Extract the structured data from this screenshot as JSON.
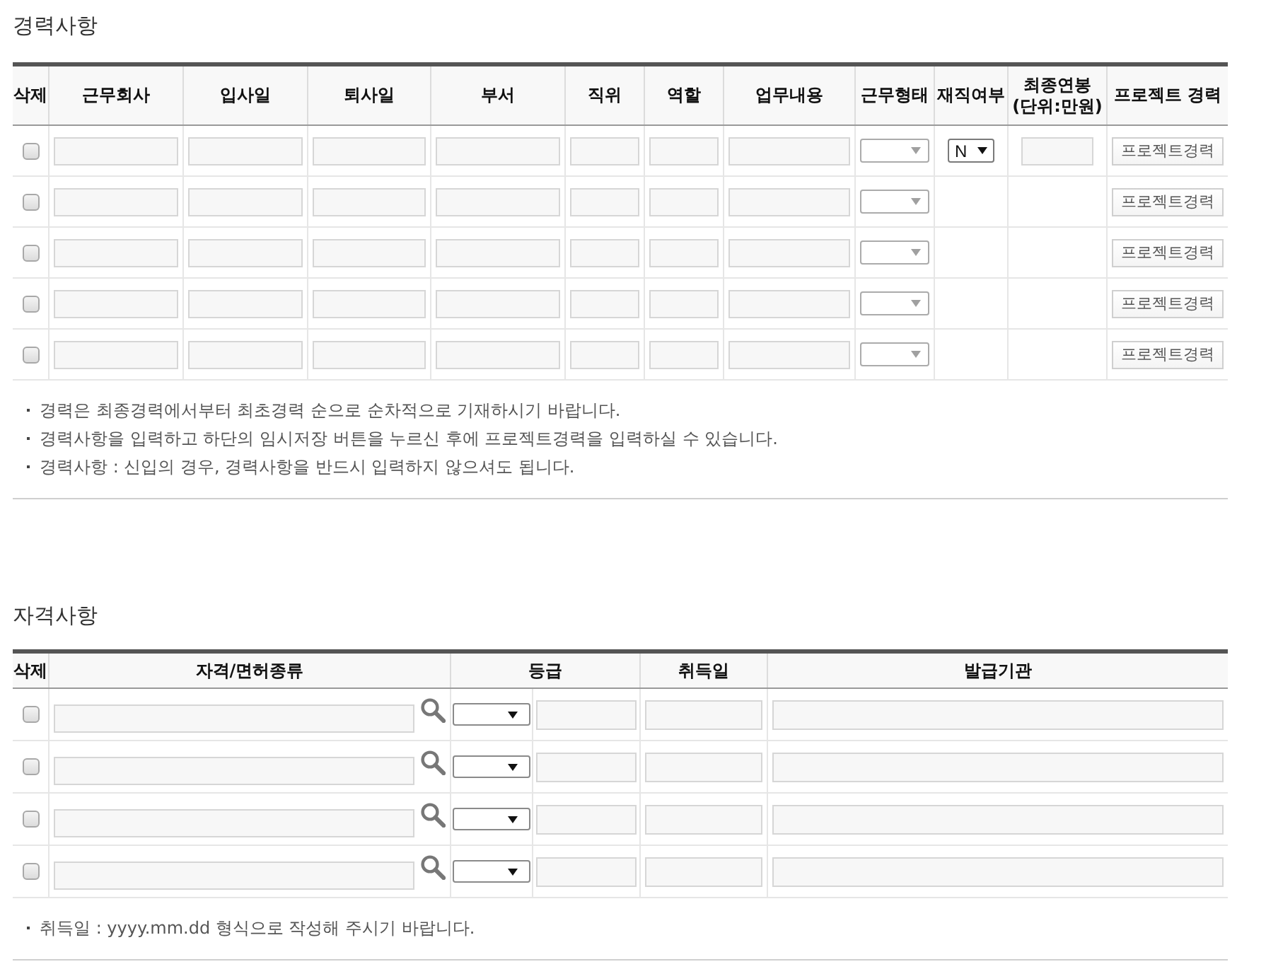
{
  "career": {
    "title": "경력사항",
    "columns": [
      "삭제",
      "근무회사",
      "입사일",
      "퇴사일",
      "부서",
      "직위",
      "역할",
      "업무내용",
      "근무형태",
      "재직여부",
      "최종연봉 (단위:만원)",
      "프로젝트 경력"
    ],
    "rows": [
      {
        "cells": [
          {
            "kind": "checkbox",
            "checked": false
          },
          {
            "kind": "input"
          },
          {
            "kind": "input"
          },
          {
            "kind": "input"
          },
          {
            "kind": "input"
          },
          {
            "kind": "input"
          },
          {
            "kind": "input"
          },
          {
            "kind": "input"
          },
          {
            "kind": "select"
          },
          {
            "kind": "select",
            "value": "N"
          },
          {
            "kind": "short_input"
          },
          {
            "kind": "button",
            "label": "프로젝트경력"
          }
        ]
      },
      {
        "cells": [
          {
            "kind": "checkbox",
            "checked": false
          },
          {
            "kind": "input"
          },
          {
            "kind": "input"
          },
          {
            "kind": "input"
          },
          {
            "kind": "input"
          },
          {
            "kind": "input"
          },
          {
            "kind": "input"
          },
          {
            "kind": "input"
          },
          {
            "kind": "select"
          },
          {
            "kind": "empty"
          },
          {
            "kind": "empty"
          },
          {
            "kind": "button",
            "label": "프로젝트경력"
          }
        ]
      },
      {
        "cells": [
          {
            "kind": "checkbox",
            "checked": false
          },
          {
            "kind": "input"
          },
          {
            "kind": "input"
          },
          {
            "kind": "input"
          },
          {
            "kind": "input"
          },
          {
            "kind": "input"
          },
          {
            "kind": "input"
          },
          {
            "kind": "input"
          },
          {
            "kind": "select"
          },
          {
            "kind": "empty"
          },
          {
            "kind": "empty"
          },
          {
            "kind": "button",
            "label": "프로젝트경력"
          }
        ]
      },
      {
        "cells": [
          {
            "kind": "checkbox",
            "checked": false
          },
          {
            "kind": "input"
          },
          {
            "kind": "input"
          },
          {
            "kind": "input"
          },
          {
            "kind": "input"
          },
          {
            "kind": "input"
          },
          {
            "kind": "input"
          },
          {
            "kind": "input"
          },
          {
            "kind": "select"
          },
          {
            "kind": "empty"
          },
          {
            "kind": "empty"
          },
          {
            "kind": "button",
            "label": "프로젝트경력"
          }
        ]
      },
      {
        "cells": [
          {
            "kind": "checkbox",
            "checked": false
          },
          {
            "kind": "input"
          },
          {
            "kind": "input"
          },
          {
            "kind": "input"
          },
          {
            "kind": "input"
          },
          {
            "kind": "input"
          },
          {
            "kind": "input"
          },
          {
            "kind": "input"
          },
          {
            "kind": "select"
          },
          {
            "kind": "empty"
          },
          {
            "kind": "empty"
          },
          {
            "kind": "button",
            "label": "프로젝트경력"
          }
        ]
      }
    ],
    "notes": [
      "경력은 최종경력에서부터 최초경력 순으로 순차적으로 기재하시기 바랍니다.",
      "경력사항을 입력하고 하단의 임시저장 버튼을 누르신 후에 프로젝트경력을 입력하실 수 있습니다.",
      "경력사항 : 신입의 경우, 경력사항을 반드시 입력하지 않으셔도 됩니다."
    ]
  },
  "licenses": {
    "title": "자격사항",
    "columns": [
      "삭제",
      "자격/면허종류",
      "등급",
      "취득일",
      "발급기관"
    ],
    "rows": [
      {
        "cells": [
          {
            "kind": "checkbox",
            "checked": false
          },
          {
            "kind": "search_input"
          },
          {
            "kind": "grade"
          },
          {
            "kind": "input"
          },
          {
            "kind": "input"
          }
        ]
      },
      {
        "cells": [
          {
            "kind": "checkbox",
            "checked": false
          },
          {
            "kind": "search_input"
          },
          {
            "kind": "grade"
          },
          {
            "kind": "input"
          },
          {
            "kind": "input"
          }
        ]
      },
      {
        "cells": [
          {
            "kind": "checkbox",
            "checked": false
          },
          {
            "kind": "search_input"
          },
          {
            "kind": "grade"
          },
          {
            "kind": "input"
          },
          {
            "kind": "input"
          }
        ]
      },
      {
        "cells": [
          {
            "kind": "checkbox",
            "checked": false
          },
          {
            "kind": "search_input"
          },
          {
            "kind": "grade"
          },
          {
            "kind": "input"
          },
          {
            "kind": "input"
          }
        ]
      }
    ],
    "notes": [
      "취득일 : yyyy.mm.dd 형식으로 작성해 주시기 바랍니다."
    ]
  }
}
